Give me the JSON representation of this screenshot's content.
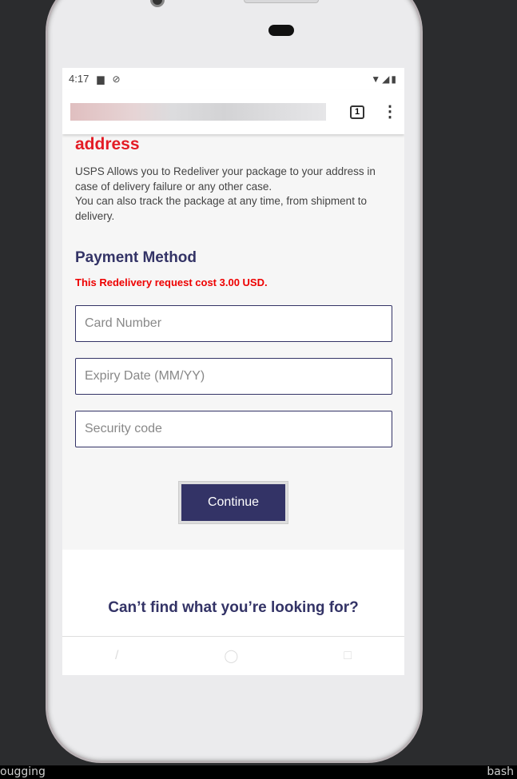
{
  "status": {
    "time": "4:17",
    "icons": [
      "sd-card-icon",
      "sync-off-icon"
    ],
    "right_icons": [
      "wifi-icon",
      "signal-icon",
      "battery-icon"
    ]
  },
  "browser": {
    "tab_count": "1"
  },
  "page": {
    "heading": "address",
    "description": [
      "USPS Allows you to Redeliver your package to your address in case of delivery failure or any other case.",
      "You can also track the package at any time, from shipment to delivery."
    ],
    "payment_title": "Payment Method",
    "cost_notice": "This Redelivery request cost 3.00 USD.",
    "fields": {
      "card_number": {
        "placeholder": "Card Number",
        "value": ""
      },
      "expiry": {
        "placeholder": "Expiry Date (MM/YY)",
        "value": ""
      },
      "security": {
        "placeholder": "Security code",
        "value": ""
      }
    },
    "continue_label": "Continue",
    "footer_title": "Can’t find what you’re looking for?"
  },
  "taskbar": {
    "left": "ougging",
    "right": "bash"
  },
  "colors": {
    "accent": "#333366",
    "alert": "#e31c25"
  }
}
